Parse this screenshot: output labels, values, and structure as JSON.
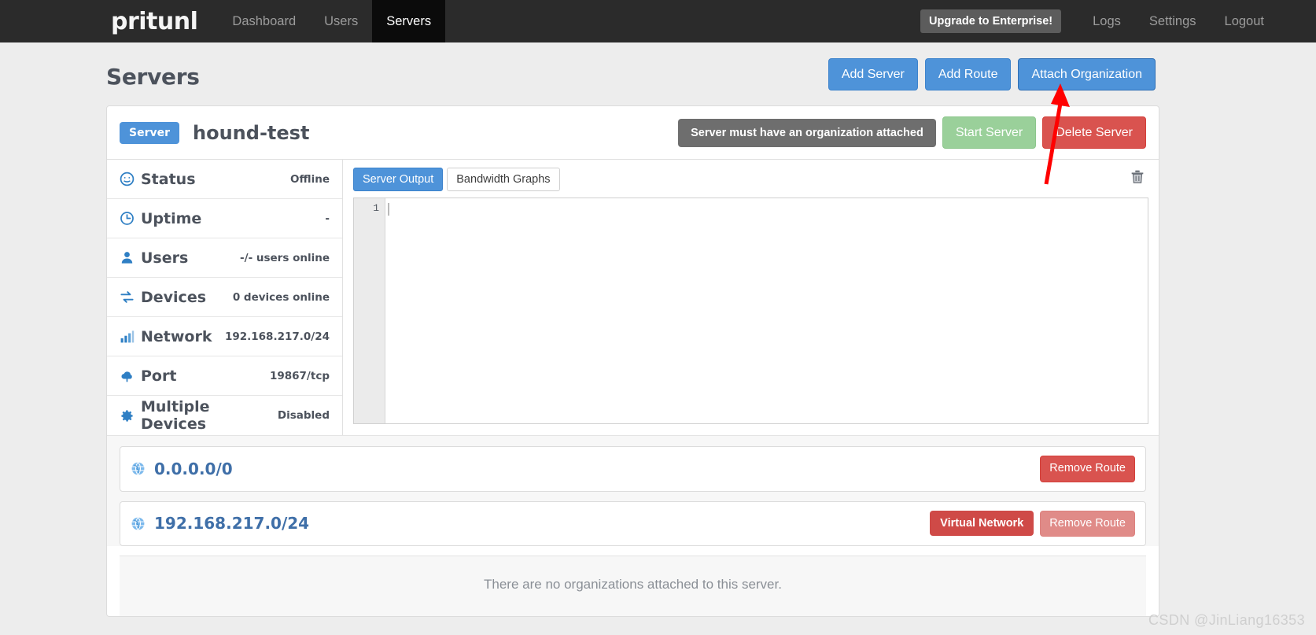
{
  "navbar": {
    "brand": "pritunl",
    "left_links": [
      {
        "label": "Dashboard",
        "active": false
      },
      {
        "label": "Users",
        "active": false
      },
      {
        "label": "Servers",
        "active": true
      }
    ],
    "upgrade_label": "Upgrade to Enterprise!",
    "right_links": [
      {
        "label": "Logs"
      },
      {
        "label": "Settings"
      },
      {
        "label": "Logout"
      }
    ]
  },
  "page": {
    "title": "Servers",
    "actions": [
      {
        "label": "Add Server",
        "name": "add-server-button"
      },
      {
        "label": "Add Route",
        "name": "add-route-button"
      },
      {
        "label": "Attach Organization",
        "name": "attach-organization-button"
      }
    ]
  },
  "server": {
    "badge": "Server",
    "name": "hound-test",
    "alert": "Server must have an organization attached",
    "start_label": "Start Server",
    "delete_label": "Delete Server",
    "info": [
      {
        "icon": "dashboard-status-icon",
        "label": "Status",
        "value": "Offline"
      },
      {
        "icon": "clock-icon",
        "label": "Uptime",
        "value": "-"
      },
      {
        "icon": "user-icon",
        "label": "Users",
        "value": "-/- users online"
      },
      {
        "icon": "devices-exchange-icon",
        "label": "Devices",
        "value": "0 devices online"
      },
      {
        "icon": "signal-bars-icon",
        "label": "Network",
        "value": "192.168.217.0/24"
      },
      {
        "icon": "cloud-upload-icon",
        "label": "Port",
        "value": "19867/tcp"
      },
      {
        "icon": "gear-icon",
        "label": "Multiple Devices",
        "value": "Disabled"
      }
    ]
  },
  "output": {
    "tabs": [
      {
        "label": "Server Output",
        "active": true
      },
      {
        "label": "Bandwidth Graphs",
        "active": false
      }
    ],
    "clear_icon": "trash-icon",
    "line_number": "1",
    "content": ""
  },
  "routes": [
    {
      "network": "0.0.0.0/0",
      "icon": "globe-icon",
      "virtual_network_label": null,
      "remove_label": "Remove Route",
      "remove_disabled": false
    },
    {
      "network": "192.168.217.0/24",
      "icon": "globe-icon",
      "virtual_network_label": "Virtual Network",
      "remove_label": "Remove Route",
      "remove_disabled": true
    }
  ],
  "organizations": {
    "empty_message": "There are no organizations attached to this server."
  },
  "watermark": "CSDN @JinLiang16353",
  "colors": {
    "navbar_bg": "#2b2b2b",
    "accent_blue": "#4e93d9",
    "danger_red": "#d9534f",
    "success_green": "#9ad09a",
    "muted_gray": "#6e6e6e",
    "annotation_red": "#ff0000"
  }
}
